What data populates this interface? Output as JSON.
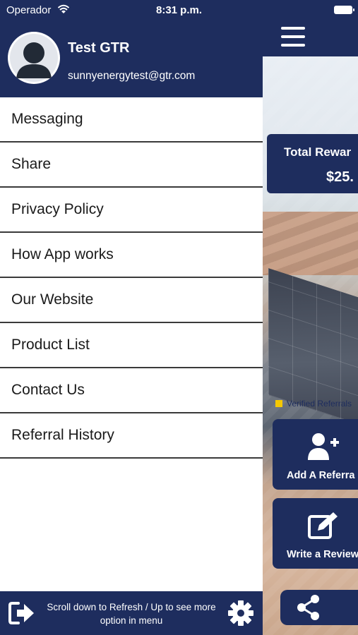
{
  "status_bar": {
    "carrier": "Operador",
    "time": "8:31 p.m."
  },
  "drawer": {
    "user": {
      "name": "Test GTR",
      "email": "sunnyenergytest@gtr.com"
    },
    "menu": [
      {
        "label": "Messaging"
      },
      {
        "label": "Share"
      },
      {
        "label": "Privacy Policy"
      },
      {
        "label": "How App works"
      },
      {
        "label": "Our Website"
      },
      {
        "label": "Product List"
      },
      {
        "label": "Contact Us"
      },
      {
        "label": "Referral History"
      }
    ],
    "footer": {
      "hint_line1": "Scroll down to Refresh / Up to see more",
      "hint_line2": "option in menu"
    }
  },
  "background": {
    "rewards_title": "Total Rewar",
    "rewards_amount": "$25.",
    "verified_label": "Verified Referrals",
    "add_referral_label": "Add A Referra",
    "write_review_label": "Write a Review"
  },
  "colors": {
    "brand_navy": "#1e2d5e",
    "legend_yellow": "#f5c800"
  },
  "icons": [
    "wifi-icon",
    "battery-icon",
    "menu-icon",
    "avatar-icon",
    "add-user-icon",
    "edit-icon",
    "share-icon",
    "logout-icon",
    "gear-icon"
  ]
}
